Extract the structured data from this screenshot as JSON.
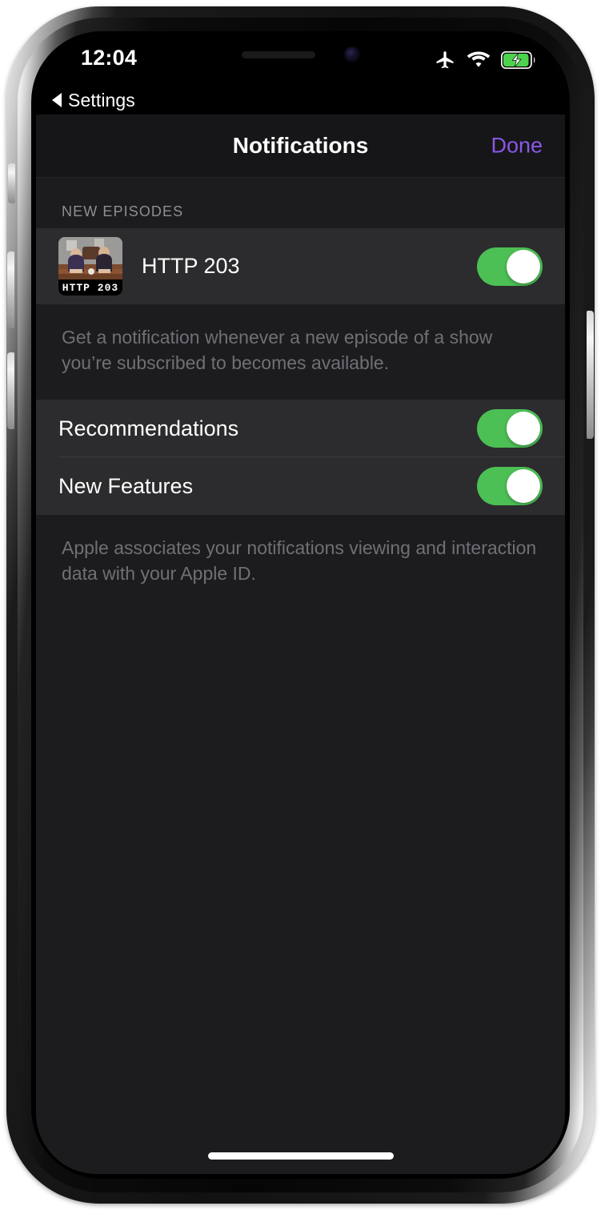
{
  "status_bar": {
    "time": "12:04",
    "icons": [
      "airplane-mode-icon",
      "wifi-icon",
      "battery-charging-icon"
    ],
    "battery_charging": true
  },
  "back_strip": {
    "label": "Settings",
    "icon": "back-triangle-icon"
  },
  "nav": {
    "title": "Notifications",
    "done_label": "Done",
    "done_color": "#8b57e6"
  },
  "sections": [
    {
      "header": "NEW EPISODES",
      "rows": [
        {
          "label": "HTTP 203",
          "artwork_caption": "HTTP 203",
          "artwork_name": "podcast-artwork-http-203",
          "toggle_on": true
        }
      ],
      "footer": "Get a notification whenever a new episode of a show you’re subscribed to becomes available."
    },
    {
      "header": "",
      "rows": [
        {
          "label": "Recommendations",
          "toggle_on": true
        },
        {
          "label": "New Features",
          "toggle_on": true
        }
      ],
      "footer": "Apple associates your notifications viewing and interaction data with your Apple ID."
    }
  ],
  "colors": {
    "accent_purple": "#8b57e6",
    "toggle_green": "#4cbf55",
    "page_background": "#1c1c1e",
    "row_background": "#2c2c2e",
    "separator": "#3a3a3c",
    "secondary_text": "#6f6f76",
    "header_text": "#8d8d93"
  },
  "home_indicator": "home-indicator-bar"
}
